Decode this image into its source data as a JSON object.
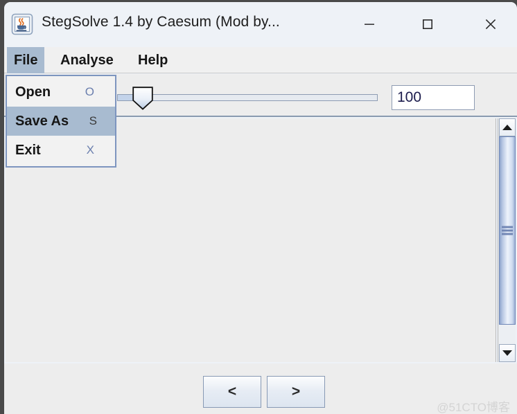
{
  "window": {
    "title": "StegSolve 1.4 by Caesum (Mod by...",
    "icon": "java-coffee-cup-icon",
    "controls": {
      "minimize": "minimize-icon",
      "maximize": "maximize-icon",
      "close": "close-icon"
    }
  },
  "menubar": {
    "items": [
      {
        "label": "File",
        "selected": true
      },
      {
        "label": "Analyse",
        "selected": false
      },
      {
        "label": "Help",
        "selected": false
      }
    ]
  },
  "file_menu": {
    "open": true,
    "items": [
      {
        "label": "Open",
        "accelerator": "O",
        "highlighted": false
      },
      {
        "label": "Save As",
        "accelerator": "S",
        "highlighted": true
      },
      {
        "label": "Exit",
        "accelerator": "X",
        "highlighted": false
      }
    ]
  },
  "toolbar": {
    "slider": {
      "value": 7,
      "min": 0,
      "max": 100
    },
    "value_field": {
      "value": "100",
      "placeholder": ""
    }
  },
  "scrollbar": {
    "up_arrow": "triangle-up-icon",
    "down_arrow": "triangle-down-icon",
    "grip": "grip-lines-icon"
  },
  "bottom_bar": {
    "prev_label": "<",
    "next_label": ">"
  },
  "watermark": {
    "text": "@51CTO博客"
  },
  "colors": {
    "menu_highlight": "#a8bbd0",
    "popup_border": "#7d95bf",
    "panel_bg": "#ededed",
    "titlebar_bg": "#eef2f7",
    "scroll_thumb": "#b6c6e2"
  }
}
